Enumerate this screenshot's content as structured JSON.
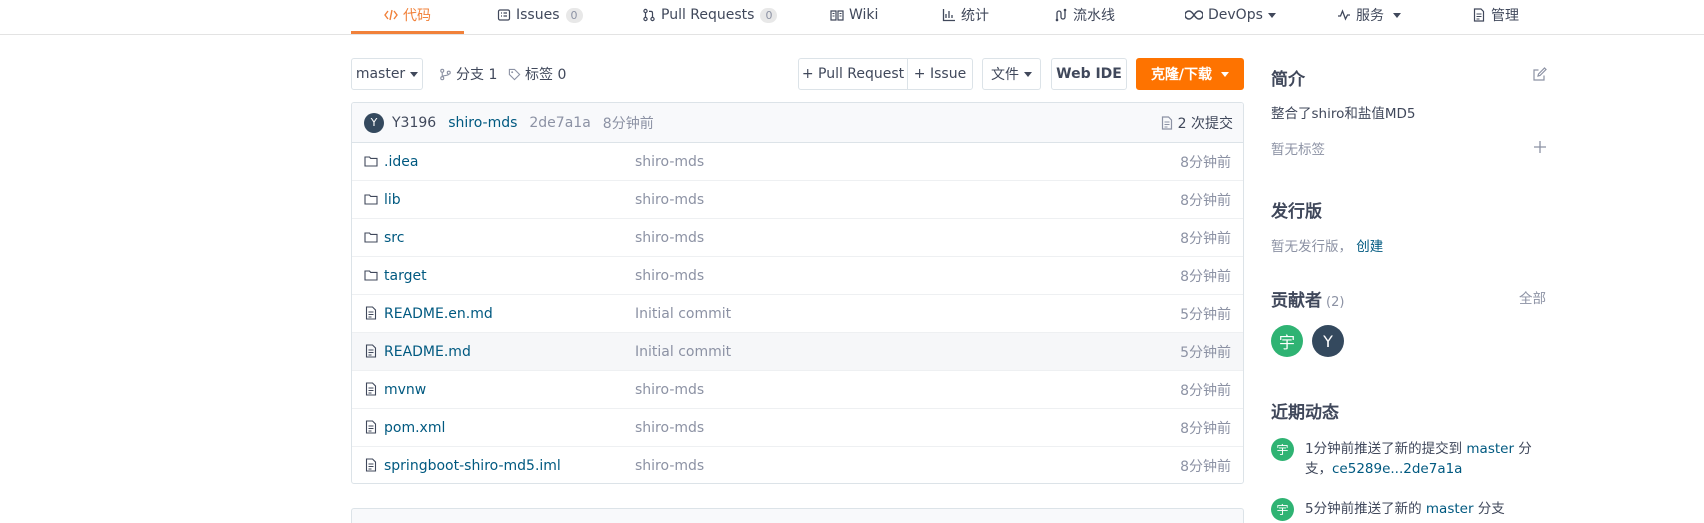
{
  "nav": {
    "tabs": [
      {
        "label": "代码",
        "icon": "code-icon",
        "active": true
      },
      {
        "label": "Issues",
        "icon": "issues-icon",
        "badge": "0"
      },
      {
        "label": "Pull Requests",
        "icon": "pull-request-icon",
        "badge": "0"
      },
      {
        "label": "Wiki",
        "icon": "wiki-icon"
      },
      {
        "label": "统计",
        "icon": "stats-icon"
      },
      {
        "label": "流水线",
        "icon": "pipeline-icon"
      },
      {
        "label": "DevOps",
        "icon": "devops-icon",
        "dropdown": true
      },
      {
        "label": "服务",
        "icon": "service-icon",
        "dropdown": true
      },
      {
        "label": "管理",
        "icon": "manage-icon"
      }
    ]
  },
  "toolbar": {
    "branch": "master",
    "branches_label": "分支 1",
    "tags_label": "标签 0",
    "pull_request_btn": "+ Pull Request",
    "issue_btn": "+ Issue",
    "file_btn": "文件",
    "webide_btn": "Web IDE",
    "clone_btn": "克隆/下载"
  },
  "commit": {
    "avatar_letter": "Y",
    "author": "Y3196",
    "message": "shiro-mds",
    "hash": "2de7a1a",
    "time": "8分钟前",
    "count_label": "2 次提交"
  },
  "files": [
    {
      "name": ".idea",
      "type": "folder",
      "message": "shiro-mds",
      "time": "8分钟前"
    },
    {
      "name": "lib",
      "type": "folder",
      "message": "shiro-mds",
      "time": "8分钟前"
    },
    {
      "name": "src",
      "type": "folder",
      "message": "shiro-mds",
      "time": "8分钟前"
    },
    {
      "name": "target",
      "type": "folder",
      "message": "shiro-mds",
      "time": "8分钟前"
    },
    {
      "name": "README.en.md",
      "type": "file",
      "message": "Initial commit",
      "time": "5分钟前"
    },
    {
      "name": "README.md",
      "type": "file",
      "message": "Initial commit",
      "time": "5分钟前"
    },
    {
      "name": "mvnw",
      "type": "file",
      "message": "shiro-mds",
      "time": "8分钟前"
    },
    {
      "name": "pom.xml",
      "type": "file",
      "message": "shiro-mds",
      "time": "8分钟前"
    },
    {
      "name": "springboot-shiro-md5.iml",
      "type": "file",
      "message": "shiro-mds",
      "time": "8分钟前"
    }
  ],
  "sidebar": {
    "intro_title": "简介",
    "intro_text": "整合了shiro和盐值MD5",
    "no_tags": "暂无标签",
    "release_title": "发行版",
    "no_release": "暂无发行版，",
    "create_link": "创建",
    "contributors_title": "贡献者",
    "contributors_count": "(2)",
    "all_link": "全部",
    "contributors": [
      "宇",
      "Y"
    ],
    "activity_title": "近期动态",
    "activities": [
      {
        "avatar": "宇",
        "prefix": "1分钟前推送了新的提交到",
        "branch": "master",
        "suffix": "分",
        "line2_prefix": "支，",
        "range": "ce5289e...2de7a1a"
      },
      {
        "avatar": "宇",
        "prefix": "5分钟前推送了新的",
        "branch": "master",
        "suffix": "分支"
      }
    ]
  }
}
